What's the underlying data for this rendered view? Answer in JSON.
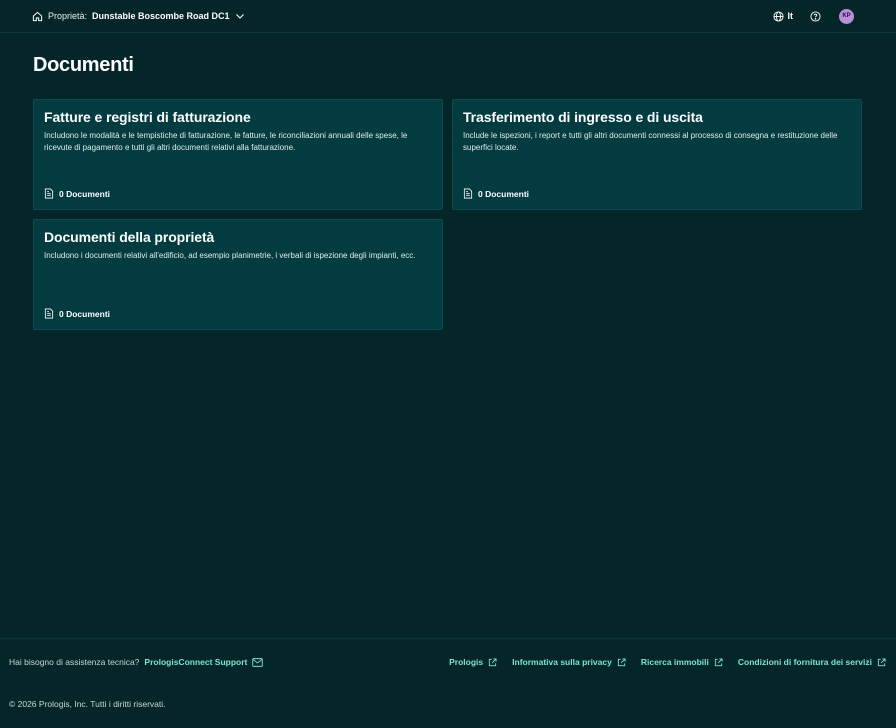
{
  "header": {
    "property_label": "Proprietà:",
    "property_value": "Dunstable Boscombe Road DC1",
    "language": "It",
    "avatar_initials": "KP"
  },
  "page": {
    "title": "Documenti"
  },
  "cards": [
    {
      "title": "Fatture e registri di fatturazione",
      "description": "Includono le modalità e le tempistiche di fatturazione, le fatture, le riconciliazioni annuali delle spese, le ricevute di pagamento e tutti gli altri documenti relativi alla fatturazione.",
      "count": "0 Documenti"
    },
    {
      "title": "Trasferimento di ingresso e di uscita",
      "description": "Include le ispezioni, i report e tutti gli altri documenti connessi al processo di consegna e restituzione delle superfici locate.",
      "count": "0 Documenti"
    },
    {
      "title": "Documenti della proprietà",
      "description": "Includono i documenti relativi all'edificio, ad esempio planimetrie, i verbali di ispezione degli impianti, ecc.",
      "count": "0 Documenti"
    }
  ],
  "footer": {
    "help_question": "Hai bisogno di assistenza tecnica?",
    "support_link": "PrologisConnect Support",
    "links": [
      "Prologis",
      "Informativa sulla privacy",
      "Ricerca immobili",
      "Condizioni di fornitura dei servizi"
    ],
    "copyright": "© 2026 Prologis, Inc. Tutti i diritti riservati."
  },
  "colors": {
    "background": "#042629",
    "card": "#023b40",
    "link": "#7fe3d6",
    "avatar": "#b98fd9"
  }
}
